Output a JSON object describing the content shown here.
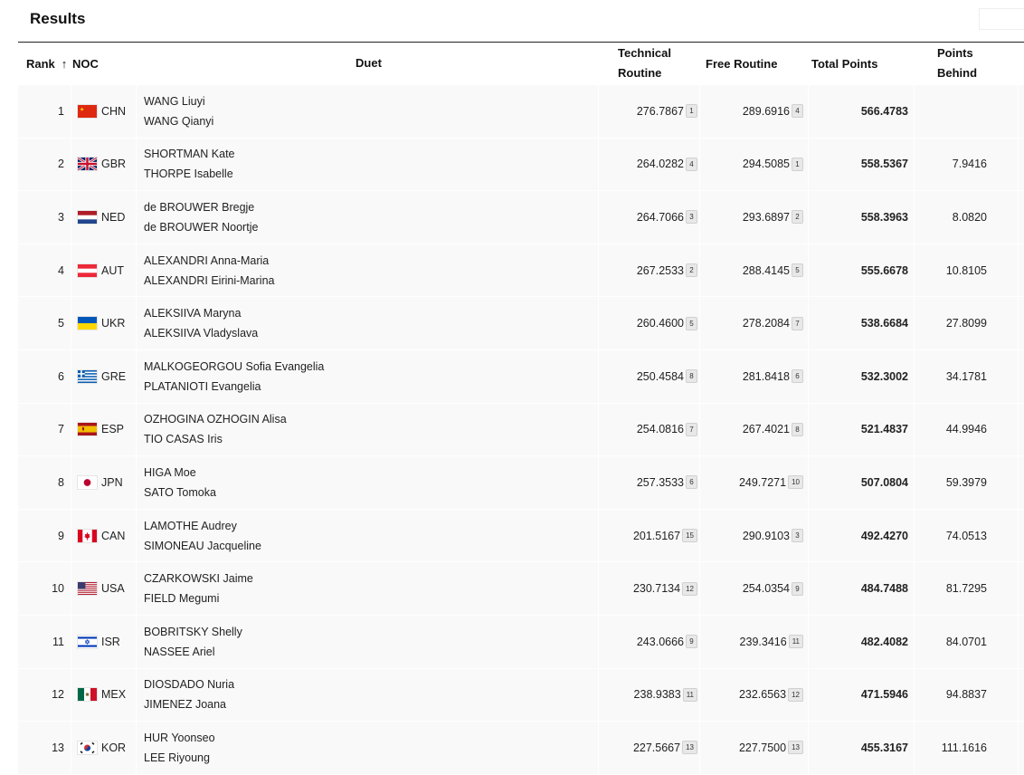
{
  "page": {
    "title": "Results"
  },
  "table": {
    "headers": {
      "rank": "Rank",
      "sort_arrow": "↑",
      "noc": "NOC",
      "duet": "Duet",
      "tech_line1": "Technical",
      "tech_line2": "Routine",
      "free": "Free Routine",
      "total": "Total Points",
      "behind_line1": "Points",
      "behind_line2": "Behind"
    },
    "rows": [
      {
        "rank": "1",
        "noc": "CHN",
        "flag": "chn-flag-icon",
        "athlete1": "WANG Liuyi",
        "athlete2": "WANG Qianyi",
        "tech": "276.7867",
        "tech_rank": "1",
        "free": "289.6916",
        "free_rank": "4",
        "total": "566.4783",
        "behind": ""
      },
      {
        "rank": "2",
        "noc": "GBR",
        "flag": "gbr-flag-icon",
        "athlete1": "SHORTMAN Kate",
        "athlete2": "THORPE Isabelle",
        "tech": "264.0282",
        "tech_rank": "4",
        "free": "294.5085",
        "free_rank": "1",
        "total": "558.5367",
        "behind": "7.9416"
      },
      {
        "rank": "3",
        "noc": "NED",
        "flag": "ned-flag-icon",
        "athlete1": "de BROUWER Bregje",
        "athlete2": "de BROUWER Noortje",
        "tech": "264.7066",
        "tech_rank": "3",
        "free": "293.6897",
        "free_rank": "2",
        "total": "558.3963",
        "behind": "8.0820"
      },
      {
        "rank": "4",
        "noc": "AUT",
        "flag": "aut-flag-icon",
        "athlete1": "ALEXANDRI Anna-Maria",
        "athlete2": "ALEXANDRI Eirini-Marina",
        "tech": "267.2533",
        "tech_rank": "2",
        "free": "288.4145",
        "free_rank": "5",
        "total": "555.6678",
        "behind": "10.8105"
      },
      {
        "rank": "5",
        "noc": "UKR",
        "flag": "ukr-flag-icon",
        "athlete1": "ALEKSIIVA Maryna",
        "athlete2": "ALEKSIIVA Vladyslava",
        "tech": "260.4600",
        "tech_rank": "5",
        "free": "278.2084",
        "free_rank": "7",
        "total": "538.6684",
        "behind": "27.8099"
      },
      {
        "rank": "6",
        "noc": "GRE",
        "flag": "gre-flag-icon",
        "athlete1": "MALKOGEORGOU Sofia Evangelia",
        "athlete2": "PLATANIOTI Evangelia",
        "tech": "250.4584",
        "tech_rank": "8",
        "free": "281.8418",
        "free_rank": "6",
        "total": "532.3002",
        "behind": "34.1781"
      },
      {
        "rank": "7",
        "noc": "ESP",
        "flag": "esp-flag-icon",
        "athlete1": "OZHOGINA OZHOGIN Alisa",
        "athlete2": "TIO CASAS Iris",
        "tech": "254.0816",
        "tech_rank": "7",
        "free": "267.4021",
        "free_rank": "8",
        "total": "521.4837",
        "behind": "44.9946"
      },
      {
        "rank": "8",
        "noc": "JPN",
        "flag": "jpn-flag-icon",
        "athlete1": "HIGA Moe",
        "athlete2": "SATO Tomoka",
        "tech": "257.3533",
        "tech_rank": "6",
        "free": "249.7271",
        "free_rank": "10",
        "total": "507.0804",
        "behind": "59.3979"
      },
      {
        "rank": "9",
        "noc": "CAN",
        "flag": "can-flag-icon",
        "athlete1": "LAMOTHE Audrey",
        "athlete2": "SIMONEAU Jacqueline",
        "tech": "201.5167",
        "tech_rank": "15",
        "free": "290.9103",
        "free_rank": "3",
        "total": "492.4270",
        "behind": "74.0513"
      },
      {
        "rank": "10",
        "noc": "USA",
        "flag": "usa-flag-icon",
        "athlete1": "CZARKOWSKI Jaime",
        "athlete2": "FIELD Megumi",
        "tech": "230.7134",
        "tech_rank": "12",
        "free": "254.0354",
        "free_rank": "9",
        "total": "484.7488",
        "behind": "81.7295"
      },
      {
        "rank": "11",
        "noc": "ISR",
        "flag": "isr-flag-icon",
        "athlete1": "BOBRITSKY Shelly",
        "athlete2": "NASSEE Ariel",
        "tech": "243.0666",
        "tech_rank": "9",
        "free": "239.3416",
        "free_rank": "11",
        "total": "482.4082",
        "behind": "84.0701"
      },
      {
        "rank": "12",
        "noc": "MEX",
        "flag": "mex-flag-icon",
        "athlete1": "DIOSDADO Nuria",
        "athlete2": "JIMENEZ Joana",
        "tech": "238.9383",
        "tech_rank": "11",
        "free": "232.6563",
        "free_rank": "12",
        "total": "471.5946",
        "behind": "94.8837"
      },
      {
        "rank": "13",
        "noc": "KOR",
        "flag": "kor-flag-icon",
        "athlete1": "HUR Yoonseo",
        "athlete2": "LEE Riyoung",
        "tech": "227.5667",
        "tech_rank": "13",
        "free": "227.7500",
        "free_rank": "13",
        "total": "455.3167",
        "behind": "111.1616"
      }
    ]
  }
}
